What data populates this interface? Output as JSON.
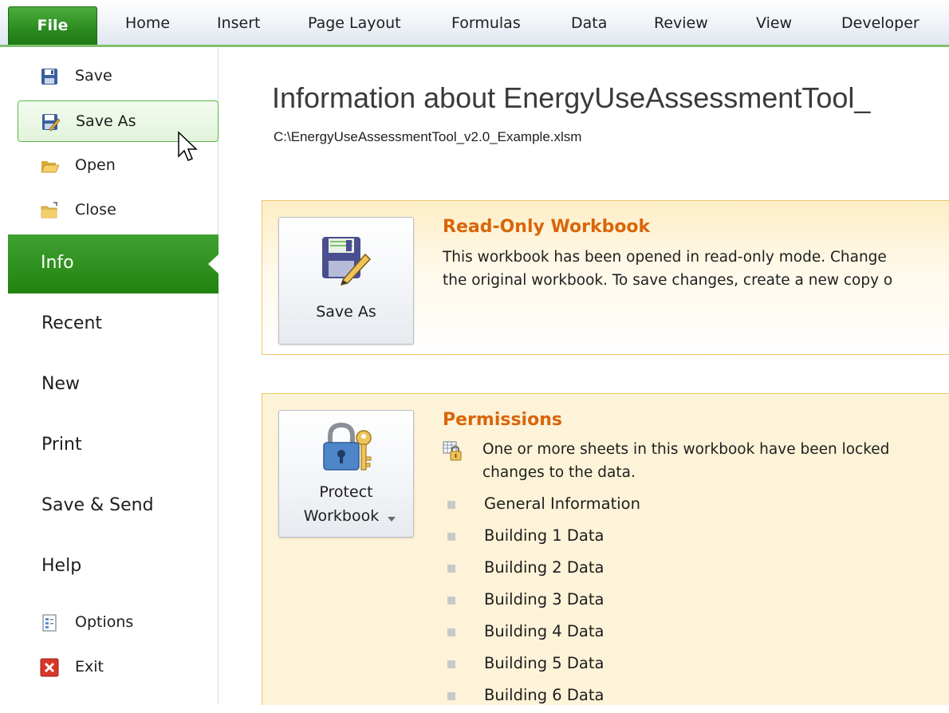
{
  "ribbon": {
    "file_tab": "File",
    "tabs": [
      "Home",
      "Insert",
      "Page Layout",
      "Formulas",
      "Data",
      "Review",
      "View",
      "Developer"
    ]
  },
  "nav": {
    "save": "Save",
    "save_as": "Save As",
    "open": "Open",
    "close": "Close",
    "info": "Info",
    "recent": "Recent",
    "new": "New",
    "print": "Print",
    "save_send": "Save & Send",
    "help": "Help",
    "options": "Options",
    "exit": "Exit"
  },
  "main": {
    "title": "Information about EnergyUseAssessmentTool_",
    "path": "C:\\EnergyUseAssessmentTool_v2.0_Example.xlsm"
  },
  "readonly": {
    "button_label": "Save As",
    "title": "Read-Only Workbook",
    "line1": "This workbook has been opened in read-only mode. Change",
    "line2": "the original workbook. To save changes, create a new copy o"
  },
  "permissions": {
    "button_line1": "Protect",
    "button_line2": "Workbook",
    "title": "Permissions",
    "line1": "One or more sheets in this workbook have been locked",
    "line2": "changes to the data.",
    "sheets": [
      "General Information",
      "Building 1 Data",
      "Building 2 Data",
      "Building 3 Data",
      "Building 4 Data",
      "Building 5 Data",
      "Building 6 Data"
    ]
  },
  "colors": {
    "file_green": "#2a8a1e",
    "section_orange": "#d9660b",
    "panel_border": "#f0c565"
  },
  "icons": [
    "save-icon",
    "save-as-icon",
    "open-folder-icon",
    "close-folder-icon",
    "options-icon",
    "exit-icon",
    "lock-sheet-icon",
    "lock-key-icon",
    "dropdown-arrow-icon",
    "mouse-cursor-icon"
  ]
}
